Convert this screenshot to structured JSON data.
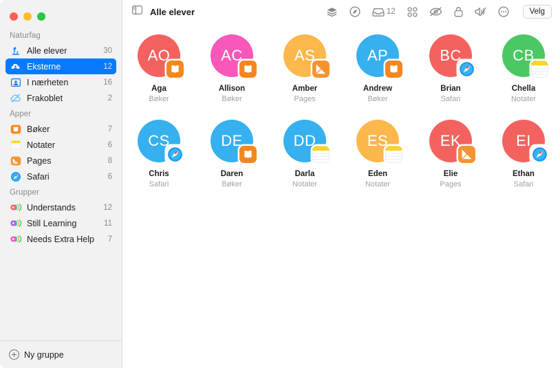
{
  "window": {
    "traffic_lights": [
      "close",
      "minimize",
      "zoom"
    ]
  },
  "header": {
    "sidebar_toggle_icon": "sidebar-icon",
    "title": "Alle elever",
    "toolbar": [
      {
        "name": "layers-icon",
        "label": ""
      },
      {
        "name": "compass-icon",
        "label": ""
      },
      {
        "name": "inbox-icon",
        "label": "12"
      },
      {
        "name": "grid-icon",
        "label": ""
      },
      {
        "name": "eye-slash-icon",
        "label": ""
      },
      {
        "name": "lock-icon",
        "label": ""
      },
      {
        "name": "speaker-mute-icon",
        "label": ""
      },
      {
        "name": "more-icon",
        "label": ""
      }
    ],
    "select_button": "Velg"
  },
  "sidebar": {
    "sections": [
      {
        "title": "Naturfag",
        "items": [
          {
            "icon": "microscope-icon",
            "label": "Alle elever",
            "count": "30",
            "selected": false
          },
          {
            "icon": "cloud-person-icon",
            "label": "Eksterne",
            "count": "12",
            "selected": true
          },
          {
            "icon": "person-frame-icon",
            "label": "I nærheten",
            "count": "16",
            "selected": false
          },
          {
            "icon": "cloud-slash-icon",
            "label": "Frakoblet",
            "count": "2",
            "selected": false
          }
        ]
      },
      {
        "title": "Apper",
        "items": [
          {
            "icon": "books-app-icon",
            "label": "Bøker",
            "count": "7",
            "selected": false
          },
          {
            "icon": "notes-app-icon",
            "label": "Notater",
            "count": "6",
            "selected": false
          },
          {
            "icon": "pages-app-icon",
            "label": "Pages",
            "count": "8",
            "selected": false
          },
          {
            "icon": "safari-app-icon",
            "label": "Safari",
            "count": "6",
            "selected": false
          }
        ]
      },
      {
        "title": "Grupper",
        "items": [
          {
            "icon": "group-red-icon",
            "label": "Understands",
            "count": "12",
            "selected": false
          },
          {
            "icon": "group-purple-icon",
            "label": "Still Learning",
            "count": "11",
            "selected": false
          },
          {
            "icon": "group-pink-icon",
            "label": "Needs Extra Help",
            "count": "7",
            "selected": false
          }
        ]
      }
    ],
    "new_group_label": "Ny gruppe"
  },
  "students": [
    {
      "initials": "AO",
      "name": "Aga",
      "app": "Bøker",
      "color": "#f4625f",
      "badge": "books"
    },
    {
      "initials": "AC",
      "name": "Allison",
      "app": "Bøker",
      "color": "#f758b9",
      "badge": "books"
    },
    {
      "initials": "AS",
      "name": "Amber",
      "app": "Pages",
      "color": "#fcb74d",
      "badge": "pages"
    },
    {
      "initials": "AP",
      "name": "Andrew",
      "app": "Bøker",
      "color": "#36b0ef",
      "badge": "books"
    },
    {
      "initials": "BC",
      "name": "Brian",
      "app": "Safari",
      "color": "#f4625f",
      "badge": "safari"
    },
    {
      "initials": "CB",
      "name": "Chella",
      "app": "Notater",
      "color": "#4cc764",
      "badge": "notes"
    },
    {
      "initials": "CS",
      "name": "Chris",
      "app": "Safari",
      "color": "#36b0ef",
      "badge": "safari"
    },
    {
      "initials": "DE",
      "name": "Daren",
      "app": "Bøker",
      "color": "#36b0ef",
      "badge": "books"
    },
    {
      "initials": "DD",
      "name": "Darla",
      "app": "Notater",
      "color": "#36b0ef",
      "badge": "notes"
    },
    {
      "initials": "ES",
      "name": "Eden",
      "app": "Notater",
      "color": "#fcb74d",
      "badge": "notes"
    },
    {
      "initials": "EK",
      "name": "Elie",
      "app": "Pages",
      "color": "#f4625f",
      "badge": "pages"
    },
    {
      "initials": "EI",
      "name": "Ethan",
      "app": "Safari",
      "color": "#f4625f",
      "badge": "safari"
    }
  ],
  "colors": {
    "accent": "#077aff",
    "sidebar_bg": "#f2f2f2",
    "books_badge": "#f4871f",
    "pages_badge": "#f59331",
    "notes_badge": "#ffd426"
  }
}
